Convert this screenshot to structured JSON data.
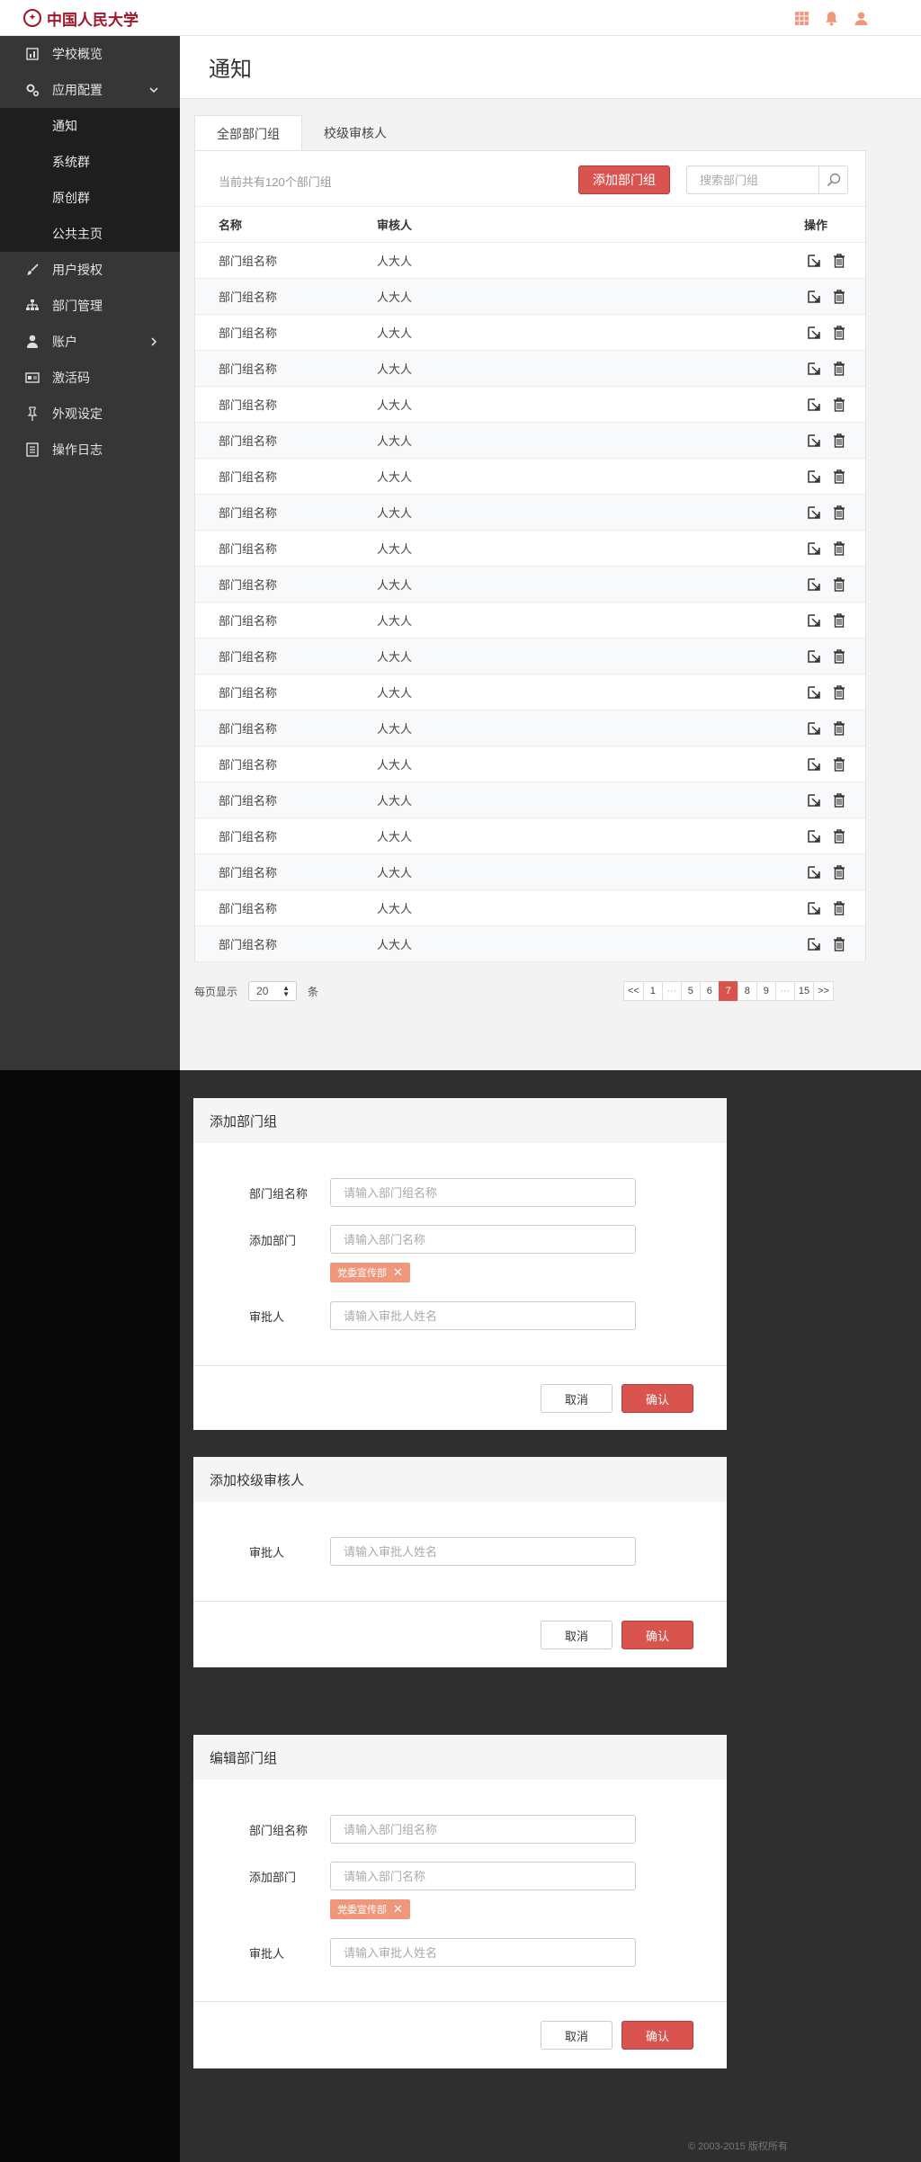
{
  "brand": {
    "logo_text": "中国人民大学",
    "accent": "#d9534f",
    "logo_color": "#a0172a"
  },
  "topbar": {
    "icons": [
      "apps-grid-icon",
      "bell-icon",
      "user-icon"
    ]
  },
  "sidebar": {
    "items": [
      {
        "label": "学校概览",
        "icon": "chart-icon"
      },
      {
        "label": "应用配置",
        "icon": "gears-icon",
        "expanded": true
      },
      {
        "label": "用户授权",
        "icon": "brush-icon"
      },
      {
        "label": "部门管理",
        "icon": "org-chart-icon"
      },
      {
        "label": "账户",
        "icon": "person-icon"
      },
      {
        "label": "激活码",
        "icon": "card-icon"
      },
      {
        "label": "外观设定",
        "icon": "pin-icon"
      },
      {
        "label": "操作日志",
        "icon": "log-icon"
      }
    ],
    "subitems": [
      "通知",
      "系统群",
      "原创群",
      "公共主页"
    ]
  },
  "page": {
    "title": "通知"
  },
  "tabs": [
    "全部部门组",
    "校级审核人"
  ],
  "toolbar": {
    "count_text": "当前共有120个部门组",
    "add_button": "添加部门组",
    "search_placeholder": "搜索部门组"
  },
  "table": {
    "headers": {
      "name": "名称",
      "reviewer": "审核人",
      "ops": "操作"
    },
    "rows": [
      {
        "name": "部门组名称",
        "reviewer": "人大人"
      },
      {
        "name": "部门组名称",
        "reviewer": "人大人"
      },
      {
        "name": "部门组名称",
        "reviewer": "人大人"
      },
      {
        "name": "部门组名称",
        "reviewer": "人大人"
      },
      {
        "name": "部门组名称",
        "reviewer": "人大人"
      },
      {
        "name": "部门组名称",
        "reviewer": "人大人"
      },
      {
        "name": "部门组名称",
        "reviewer": "人大人"
      },
      {
        "name": "部门组名称",
        "reviewer": "人大人"
      },
      {
        "name": "部门组名称",
        "reviewer": "人大人"
      },
      {
        "name": "部门组名称",
        "reviewer": "人大人"
      },
      {
        "name": "部门组名称",
        "reviewer": "人大人"
      },
      {
        "name": "部门组名称",
        "reviewer": "人大人"
      },
      {
        "name": "部门组名称",
        "reviewer": "人大人"
      },
      {
        "name": "部门组名称",
        "reviewer": "人大人"
      },
      {
        "name": "部门组名称",
        "reviewer": "人大人"
      },
      {
        "name": "部门组名称",
        "reviewer": "人大人"
      },
      {
        "name": "部门组名称",
        "reviewer": "人大人"
      },
      {
        "name": "部门组名称",
        "reviewer": "人大人"
      },
      {
        "name": "部门组名称",
        "reviewer": "人大人"
      },
      {
        "name": "部门组名称",
        "reviewer": "人大人"
      }
    ]
  },
  "pagesize": {
    "label": "每页显示",
    "value": "20",
    "unit": "条"
  },
  "pagination": {
    "pages": [
      "<<",
      "1",
      "···",
      "5",
      "6",
      "7",
      "8",
      "9",
      "···",
      "15",
      ">>"
    ],
    "current": "7"
  },
  "dialog_add": {
    "title": "添加部门组",
    "name_label": "部门组名称",
    "name_placeholder": "请输入部门组名称",
    "dept_label": "添加部门",
    "dept_placeholder": "请输入部门名称",
    "tag": "党委宣传部",
    "approver_label": "审批人",
    "approver_placeholder": "请输入审批人姓名",
    "cancel": "取消",
    "confirm": "确认"
  },
  "dialog_reviewer": {
    "title": "添加校级审核人",
    "approver_label": "审批人",
    "approver_placeholder": "请输入审批人姓名",
    "cancel": "取消",
    "confirm": "确认"
  },
  "dialog_edit": {
    "title": "编辑部门组",
    "name_label": "部门组名称",
    "name_placeholder": "请输入部门组名称",
    "dept_label": "添加部门",
    "dept_placeholder": "请输入部门名称",
    "tag": "党委宣传部",
    "approver_label": "审批人",
    "approver_placeholder": "请输入审批人姓名",
    "cancel": "取消",
    "confirm": "确认"
  },
  "footer": {
    "text": "© 2003-2015 版权所有"
  }
}
